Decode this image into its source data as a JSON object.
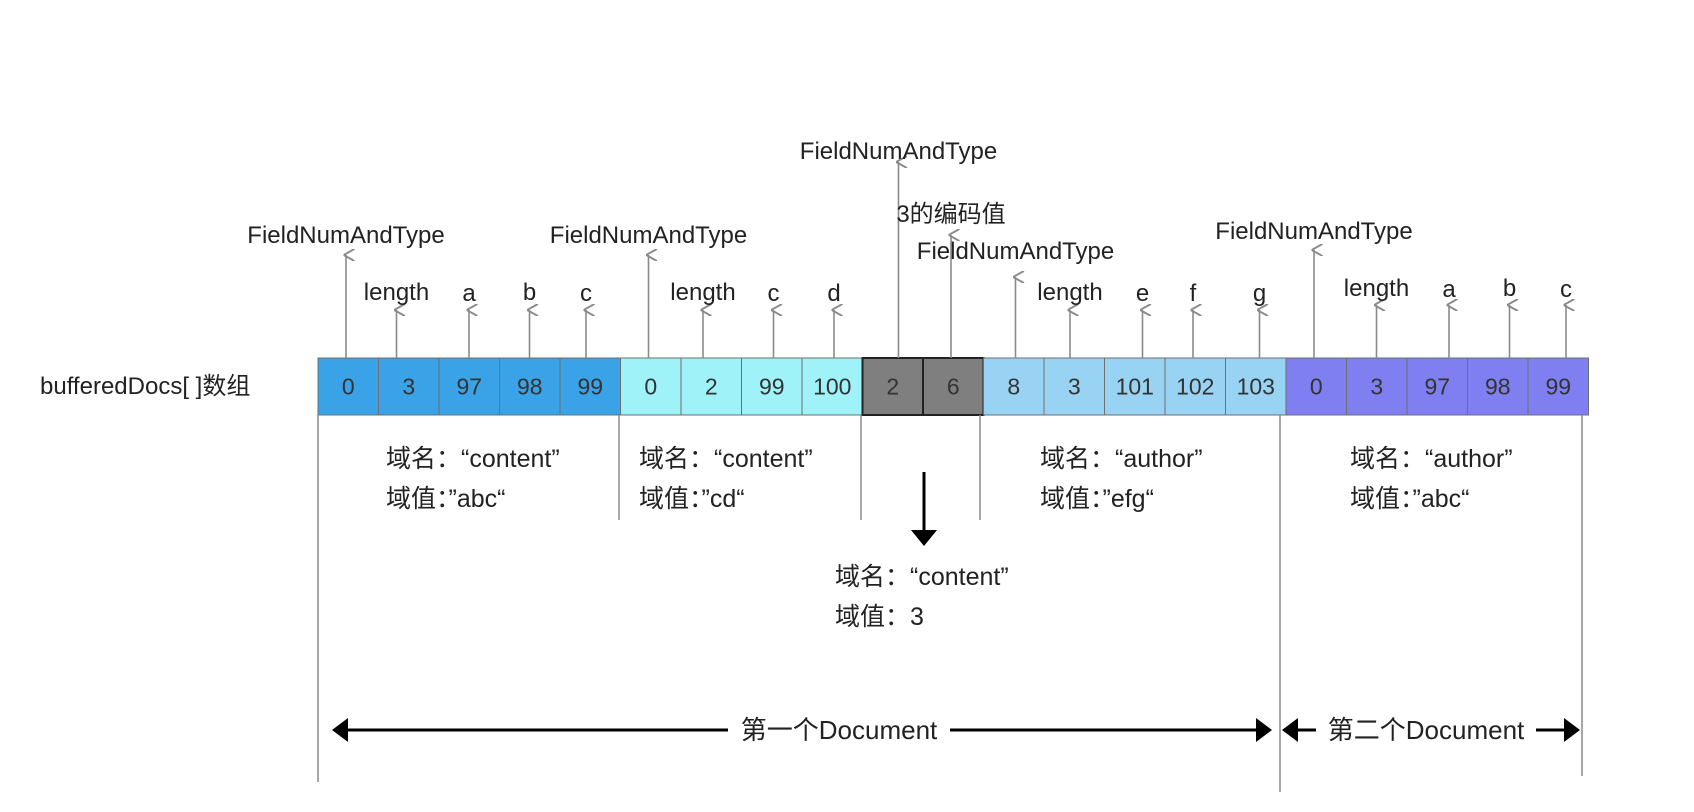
{
  "array_label": "bufferedDocs[ ]数组",
  "cells": [
    {
      "value": "0",
      "color": "#3aa2e6"
    },
    {
      "value": "3",
      "color": "#3aa2e6"
    },
    {
      "value": "97",
      "color": "#3aa2e6"
    },
    {
      "value": "98",
      "color": "#3aa2e6"
    },
    {
      "value": "99",
      "color": "#3aa2e6"
    },
    {
      "value": "0",
      "color": "#9ff2f8"
    },
    {
      "value": "2",
      "color": "#9ff2f8"
    },
    {
      "value": "99",
      "color": "#9ff2f8"
    },
    {
      "value": "100",
      "color": "#9ff2f8"
    },
    {
      "value": "2",
      "color": "#7f7f7f"
    },
    {
      "value": "6",
      "color": "#7f7f7f"
    },
    {
      "value": "8",
      "color": "#98d3f4"
    },
    {
      "value": "3",
      "color": "#98d3f4"
    },
    {
      "value": "101",
      "color": "#98d3f4"
    },
    {
      "value": "102",
      "color": "#98d3f4"
    },
    {
      "value": "103",
      "color": "#98d3f4"
    },
    {
      "value": "0",
      "color": "#7f7ff2"
    },
    {
      "value": "3",
      "color": "#7f7ff2"
    },
    {
      "value": "97",
      "color": "#7f7ff2"
    },
    {
      "value": "98",
      "color": "#7f7ff2"
    },
    {
      "value": "99",
      "color": "#7f7ff2"
    }
  ],
  "pointers": [
    {
      "cell": 0,
      "text": "FieldNumAndType"
    },
    {
      "cell": 1,
      "text": "length"
    },
    {
      "cell": 2,
      "text": "a"
    },
    {
      "cell": 3,
      "text": "b"
    },
    {
      "cell": 4,
      "text": "c"
    },
    {
      "cell": 5,
      "text": "FieldNumAndType"
    },
    {
      "cell": 6,
      "text": "length"
    },
    {
      "cell": 7,
      "text": "c"
    },
    {
      "cell": 8,
      "text": "d"
    },
    {
      "cell": 9,
      "text": "FieldNumAndType"
    },
    {
      "cell": 10,
      "text": "3的编码值"
    },
    {
      "cell": 11,
      "text": "FieldNumAndType"
    },
    {
      "cell": 12,
      "text": "length"
    },
    {
      "cell": 13,
      "text": "e"
    },
    {
      "cell": 14,
      "text": "f"
    },
    {
      "cell": 15,
      "text": "g"
    },
    {
      "cell": 16,
      "text": "FieldNumAndType"
    },
    {
      "cell": 17,
      "text": "length"
    },
    {
      "cell": 18,
      "text": "a"
    },
    {
      "cell": 19,
      "text": "b"
    },
    {
      "cell": 20,
      "text": "c"
    }
  ],
  "fields": [
    {
      "name_line": "域名：“content”",
      "value_line": "域值：”abc“"
    },
    {
      "name_line": "域名：“content”",
      "value_line": "域值：”cd“"
    },
    {
      "name_line": "域名：“content”",
      "value_line": "域值：3"
    },
    {
      "name_line": "域名：“author”",
      "value_line": "域值：”efg“"
    },
    {
      "name_line": "域名：“author”",
      "value_line": "域值：”abc“"
    }
  ],
  "documents": [
    "第一个Document",
    "第二个Document"
  ],
  "colors": {
    "line": "#8a8a8a",
    "arrow": "#000000",
    "cell_border": "#6f6f6f"
  }
}
